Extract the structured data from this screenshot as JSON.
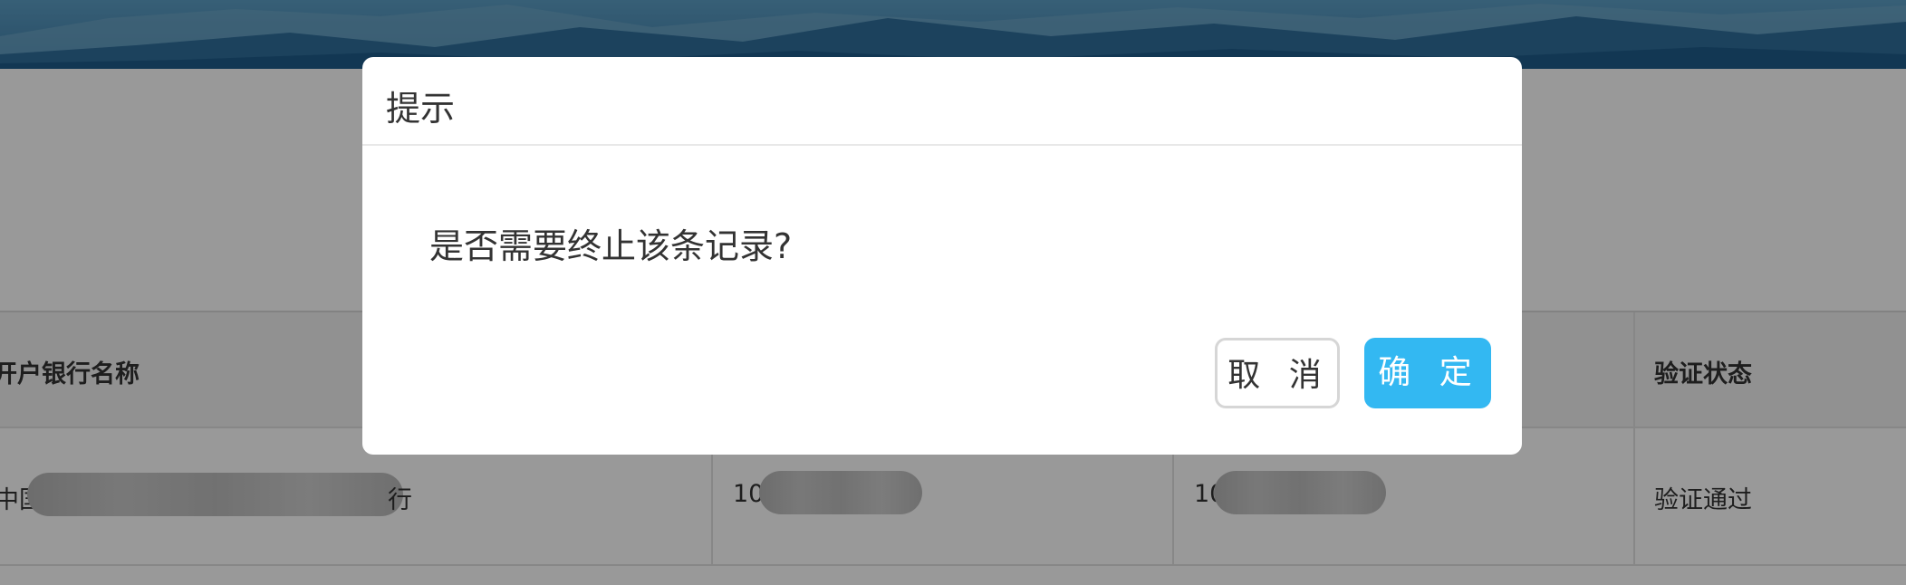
{
  "dialog": {
    "title": "提示",
    "message": "是否需要终止该条记录?",
    "cancel_label": "取 消",
    "confirm_label": "确 定"
  },
  "table": {
    "headers": {
      "bank_name": "开户银行名称",
      "verify_status": "验证状态"
    },
    "rows": [
      {
        "bank_prefix": "中国",
        "bank_suffix": "行",
        "col2_prefix": "10",
        "col3_prefix": "10",
        "verify_status": "验证通过"
      }
    ]
  },
  "colors": {
    "confirm_button": "#33b8f2",
    "banner_sky": "#4e8bb5",
    "overlay": "rgba(0,0,0,0.4)"
  }
}
